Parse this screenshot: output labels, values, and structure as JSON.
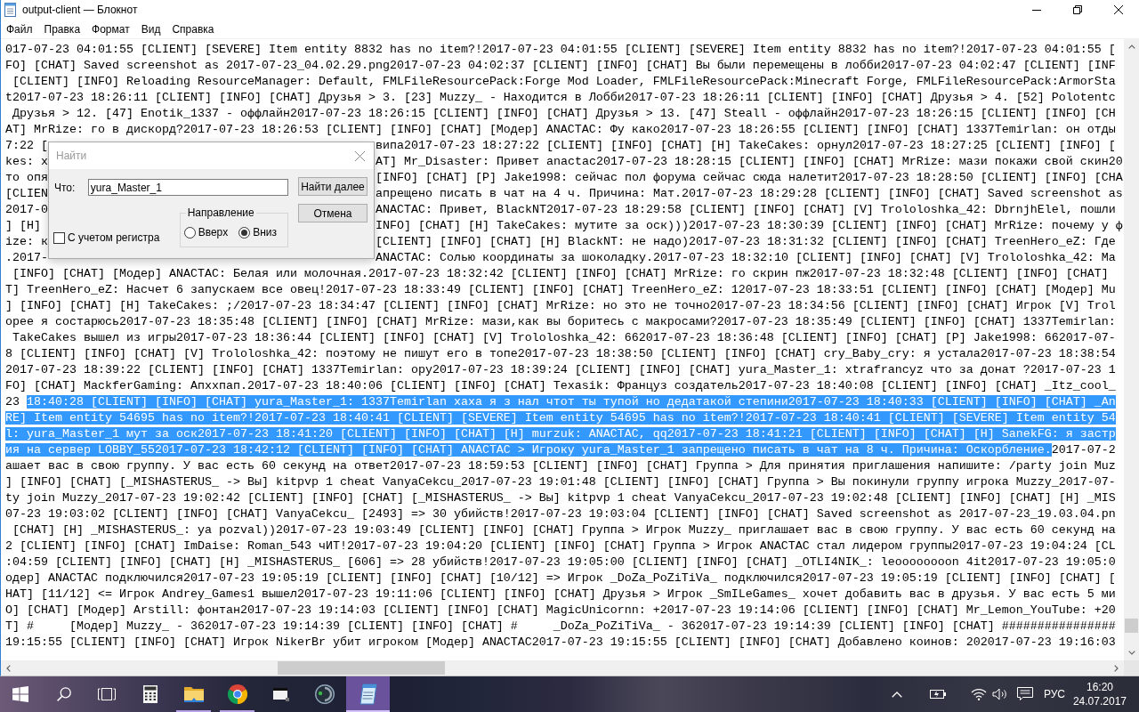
{
  "window": {
    "title": "output-client — Блокнот"
  },
  "menu": [
    "Файл",
    "Правка",
    "Формат",
    "Вид",
    "Справка"
  ],
  "editor": {
    "lines": [
      {
        "segments": [
          {
            "text": "017-07-23 04:01:55 [CLIENT] [SEVERE] Item entity 8832 has no item?!2017-07-23 04:01:55 [CLIENT] [SEVERE] Item entity 8832 has no item?!2017-07-23 04:01:55 [",
            "selected": false
          }
        ]
      },
      {
        "segments": [
          {
            "text": "FO] [CHAT] Saved screenshot as 2017-07-23_04.02.29.png2017-07-23 04:02:37 [CLIENT] [INFO] [CHAT] Вы были перемещены в лобби2017-07-23 04:02:47 [CLIENT] [INF",
            "selected": false
          }
        ]
      },
      {
        "segments": [
          {
            "text": " [CLIENT] [INFO] Reloading ResourceManager: Default, FMLFileResourcePack:Forge Mod Loader, FMLFileResourcePack:Minecraft Forge, FMLFileResourcePack:ArmorSta",
            "selected": false
          }
        ]
      },
      {
        "segments": [
          {
            "text": "t2017-07-23 18:26:11 [CLIENT] [INFO] [CHAT] Друзья > 3. [23] Muzzy_ - Находится в Лобби2017-07-23 18:26:11 [CLIENT] [INFO] [CHAT] Друзья > 4. [52] Polotentc",
            "selected": false
          }
        ]
      },
      {
        "segments": [
          {
            "text": " Друзья > 12. [47] Enotik_1337 - оффлайн2017-07-23 18:26:15 [CLIENT] [INFO] [CHAT] Друзья > 13. [47] Steall - оффлайн2017-07-23 18:26:15 [CLIENT] [INFO] [CH",
            "selected": false
          }
        ]
      },
      {
        "segments": [
          {
            "text": "AT] MrRize: го в дискорд?2017-07-23 18:26:53 [CLIENT] [INFO] [CHAT] [Модер] ANACTAC: Фу како2017-07-23 18:26:55 [CLIENT] [INFO] [CHAT] 1337Temirlan: он отды",
            "selected": false
          }
        ]
      },
      {
        "left_of_dialog": "7:22 [",
        "right_of_dialog": "випа2017-07-23 18:27:22 [CLIENT] [INFO] [CHAT] [H] TakeCakes: орнул2017-07-23 18:27:25 [CLIENT] [INFO] ["
      },
      {
        "left_of_dialog": "kes: х",
        "right_of_dialog": "AT] Mr_Disaster: Привет anactac2017-07-23 18:28:15 [CLIENT] [INFO] [CHAT] MrRize: мази покажи свой скин20"
      },
      {
        "left_of_dialog": "то опя",
        "right_of_dialog": "[INFO] [CHAT] [P] Jake1998: сейчас пол форума сейчас сюда налетит2017-07-23 18:28:50 [CLIENT] [INFO] [CHA"
      },
      {
        "left_of_dialog": "[CLIEN",
        "right_of_dialog": "апрещено писать в чат на 4 ч. Причина: Мат.2017-07-23 18:29:28 [CLIENT] [INFO] [CHAT] Saved screenshot as"
      },
      {
        "left_of_dialog": "2017-0",
        "right_of_dialog": "ANACTAC: Привет, BlackNT2017-07-23 18:29:58 [CLIENT] [INFO] [CHAT] [V] Trololoshka_42: DbrnjhElel, пошли"
      },
      {
        "left_of_dialog": "] [H]",
        "right_of_dialog": "INFO] [CHAT] [H] TakeCakes: мутите за оск)))2017-07-23 18:30:39 [CLIENT] [INFO] [CHAT] MrRize: почему у ф"
      },
      {
        "left_of_dialog": "ize: к",
        "right_of_dialog": "[CLIENT] [INFO] [CHAT] [H] BlackNT: не надо)2017-07-23 18:31:32 [CLIENT] [INFO] [CHAT] TreenHero_eZ: Где"
      },
      {
        "left_of_dialog": ".2017-",
        "right_of_dialog": "ANACTAC: Солью координаты за шоколадку.2017-07-23 18:32:10 [CLIENT] [INFO] [CHAT] [V] Trololoshka_42: Ма"
      },
      {
        "segments": [
          {
            "text": " [INFO] [CHAT] [Модер] ANACTAC: Белая или молочная.2017-07-23 18:32:42 [CLIENT] [INFO] [CHAT] MrRize: го скрин пж2017-07-23 18:32:48 [CLIENT] [INFO] [CHAT]",
            "selected": false
          }
        ]
      },
      {
        "segments": [
          {
            "text": "T] TreenHero_eZ: Насчет 6 запускаем все овец!2017-07-23 18:33:49 [CLIENT] [INFO] [CHAT] TreenHero_eZ: 12017-07-23 18:33:51 [CLIENT] [INFO] [CHAT] [Модер] Mu",
            "selected": false
          }
        ]
      },
      {
        "segments": [
          {
            "text": "] [INFO] [CHAT] [H] TakeCakes: ;/2017-07-23 18:34:47 [CLIENT] [INFO] [CHAT] MrRize: но это не точно2017-07-23 18:34:56 [CLIENT] [INFO] [CHAT] Игрок [V] Trol",
            "selected": false
          }
        ]
      },
      {
        "segments": [
          {
            "text": "орее я состарюсь2017-07-23 18:35:48 [CLIENT] [INFO] [CHAT] MrRize: мази,как вы боритесь с макросами?2017-07-23 18:35:49 [CLIENT] [INFO] [CHAT] 1337Temirlan:",
            "selected": false
          }
        ]
      },
      {
        "segments": [
          {
            "text": " TakeCakes вышел из игры2017-07-23 18:36:44 [CLIENT] [INFO] [CHAT] [V] Trololoshka_42: 662017-07-23 18:36:48 [CLIENT] [INFO] [CHAT] [P] Jake1998: 662017-07-",
            "selected": false
          }
        ]
      },
      {
        "segments": [
          {
            "text": "8 [CLIENT] [INFO] [CHAT] [V] Trololoshka_42: поэтому не пишут его в топе2017-07-23 18:38:50 [CLIENT] [INFO] [CHAT] cry_Baby_cry: я устала2017-07-23 18:38:54",
            "selected": false
          }
        ]
      },
      {
        "segments": [
          {
            "text": "2017-07-23 18:39:22 [CLIENT] [INFO] [CHAT] 1337Temirlan: ору2017-07-23 18:39:24 [CLIENT] [INFO] [CHAT] yura_Master_1: xtrafrancyz что за донат ?2017-07-23 1",
            "selected": false
          }
        ]
      },
      {
        "segments": [
          {
            "text": "FO] [CHAT] MackferGaming: Апххпап.2017-07-23 18:40:06 [CLIENT] [INFO] [CHAT] Texasik: Француз создатель2017-07-23 18:40:08 [CLIENT] [INFO] [CHAT] _Itz_cool_",
            "selected": false
          }
        ]
      },
      {
        "segments": [
          {
            "text": "23 ",
            "selected": false
          },
          {
            "text": "18:40:28 [CLIENT] [INFO] [CHAT] yura_Master_1: 1337Temirlan хаха я з нал чтот ты тупой но дедатакой степини2017-07-23 18:40:33 [CLIENT] [INFO] [CHAT] _An",
            "selected": true
          }
        ]
      },
      {
        "segments": [
          {
            "text": "RE] Item entity 54695 has no item?!2017-07-23 18:40:41 [CLIENT] [SEVERE] Item entity 54695 has no item?!2017-07-23 18:40:41 [CLIENT] [SEVERE] Item entity 54",
            "selected": true
          }
        ]
      },
      {
        "segments": [
          {
            "text": "l: yura_Master_1 мут за оск2017-07-23 18:41:20 [CLIENT] [INFO] [CHAT] [H] murzuk: ANACTAC, qq2017-07-23 18:41:21 [CLIENT] [INFO] [CHAT] [H] SanekFG: я застр",
            "selected": true
          }
        ]
      },
      {
        "segments": [
          {
            "text": "ия на сервер LOBBY_552017-07-23 18:42:12 [CLIENT] [INFO] [CHAT] ANACTAC > Игроку yura_Master_1 запрещено писать в чат на 8 ч. Причина: Оскорбление.",
            "selected": true
          },
          {
            "text": "2017-07-2",
            "selected": false
          }
        ]
      },
      {
        "segments": [
          {
            "text": "ашает вас в свою группу. У вас есть 60 секунд на ответ2017-07-23 18:59:53 [CLIENT] [INFO] [CHAT] Группа > Для принятия приглашения напишите: /party join Muz",
            "selected": false
          }
        ]
      },
      {
        "segments": [
          {
            "text": "] [INFO] [CHAT] [_MISHASTERUS_ -> Вы] kitpvp 1 cheat VanyaCekcu_2017-07-23 19:01:48 [CLIENT] [INFO] [CHAT] Группа > Вы покинули группу игрока Muzzy_2017-07-",
            "selected": false
          }
        ]
      },
      {
        "segments": [
          {
            "text": "ty join Muzzy_2017-07-23 19:02:42 [CLIENT] [INFO] [CHAT] [_MISHASTERUS_ -> Вы] kitpvp 1 cheat VanyaCekcu_2017-07-23 19:02:48 [CLIENT] [INFO] [CHAT] [H] _MIS",
            "selected": false
          }
        ]
      },
      {
        "segments": [
          {
            "text": "07-23 19:03:02 [CLIENT] [INFO] [CHAT] VanyaCekcu_ [2493] => 30 убийств!2017-07-23 19:03:04 [CLIENT] [INFO] [CHAT] Saved screenshot as 2017-07-23_19.03.04.pn",
            "selected": false
          }
        ]
      },
      {
        "segments": [
          {
            "text": " [CHAT] [H] _MISHASTERUS_: ya pozval))2017-07-23 19:03:49 [CLIENT] [INFO] [CHAT] Группа > Игрок Muzzy_ приглашает вас в свою группу. У вас есть 60 секунд на",
            "selected": false
          }
        ]
      },
      {
        "segments": [
          {
            "text": "2 [CLIENT] [INFO] [CHAT] ImDaise: Roman_543 чИТ!2017-07-23 19:04:20 [CLIENT] [INFO] [CHAT] Группа > Игрок ANACTAC стал лидером группы2017-07-23 19:04:24 [CL",
            "selected": false
          }
        ]
      },
      {
        "segments": [
          {
            "text": ":04:59 [CLIENT] [INFO] [CHAT] [H] _MISHASTERUS_ [606] => 28 убийств!2017-07-23 19:05:00 [CLIENT] [INFO] [CHAT] _OTLI4NIK_: leoooooooon 4it2017-07-23 19:05:0",
            "selected": false
          }
        ]
      },
      {
        "segments": [
          {
            "text": "одер] ANACTAC подключился2017-07-23 19:05:19 [CLIENT] [INFO] [CHAT] [10/12] => Игрок _DoZa_PoZiTiVa_ подключился2017-07-23 19:05:19 [CLIENT] [INFO] [CHAT] [",
            "selected": false
          }
        ]
      },
      {
        "segments": [
          {
            "text": "HAT] [11/12] <= Игрок Andrey_Games1 вышел2017-07-23 19:11:06 [CLIENT] [INFO] [CHAT] Друзья > Игрок _SmILeGames_ хочет добавить вас в друзья. У вас есть 5 ми",
            "selected": false
          }
        ]
      },
      {
        "segments": [
          {
            "text": "O] [CHAT] [Модер] Arstill: фонтан2017-07-23 19:14:03 [CLIENT] [INFO] [CHAT] MagicUnicornn: +2017-07-23 19:14:06 [CLIENT] [INFO] [CHAT] Mr_Lemon_YouTube: +20",
            "selected": false
          }
        ]
      },
      {
        "segments": [
          {
            "text": "T] #     [Модер] Muzzy_ - 362017-07-23 19:14:39 [CLIENT] [INFO] [CHAT] #     _DoZa_PoZiTiVa_ - 362017-07-23 19:14:39 [CLIENT] [INFO] [CHAT] ################",
            "selected": false
          }
        ]
      },
      {
        "segments": [
          {
            "text": "19:15:55 [CLIENT] [INFO] [CHAT] Игрок NikerBr убит игроком [Модер] ANACTAC2017-07-23 19:15:55 [CLIENT] [INFO] [CHAT] Добавлено коинов: 202017-07-23 19:16:03",
            "selected": false
          }
        ]
      }
    ]
  },
  "find_dialog": {
    "title": "Найти",
    "find_label": "Что:",
    "find_value": "yura_Master_1",
    "find_next_button": "Найти далее",
    "cancel_button": "Отмена",
    "match_case": {
      "label": "С учетом регистра",
      "checked": false
    },
    "direction_label": "Направление",
    "directions": [
      {
        "label": "Вверх",
        "selected": false
      },
      {
        "label": "Вниз",
        "selected": true
      }
    ]
  },
  "taskbar": {
    "apps": [
      {
        "active": false,
        "running": false
      },
      {
        "active": false,
        "running": true
      },
      {
        "active": false,
        "running": true
      },
      {
        "active": false,
        "running": false
      },
      {
        "active": false,
        "running": false
      },
      {
        "active": true,
        "running": true
      }
    ],
    "language": "РУС",
    "time": "16:20",
    "date": "24.07.2017"
  }
}
